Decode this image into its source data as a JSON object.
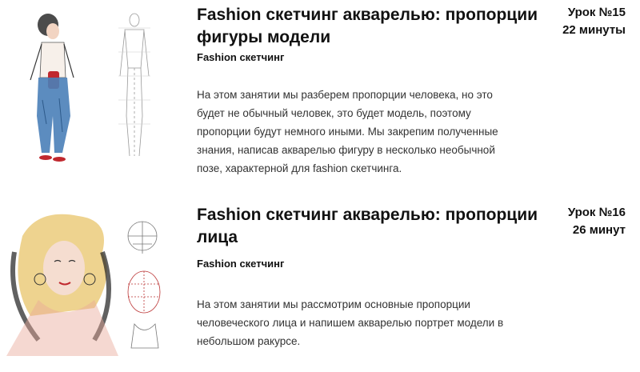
{
  "lessons": [
    {
      "title": "Fashion скетчинг акварелью: пропорции фигуры модели",
      "category": "Fashion скетчинг",
      "description": "На этом занятии мы разберем пропорции человека, но это будет не обычный человек, это будет модель, поэтому пропорции будут немного иными. Мы закрепим полученные знания, написав акварелью фигуру в несколько необычной позе, характерной для fashion скетчинга.",
      "lesson_number": "Урок №15",
      "duration": "22 минуты"
    },
    {
      "title": "Fashion скетчинг акварелью: пропорции лица",
      "category": "Fashion скетчинг",
      "description": "На этом занятии мы рассмотрим основные пропорции человеческого лица и напишем акварелью портрет модели в небольшом ракурсе.",
      "lesson_number": "Урок №16",
      "duration": "26 минут"
    }
  ],
  "colors": {
    "jeans": "#4a7fb8",
    "bag": "#c0282e",
    "hair": "#e8c46a"
  }
}
